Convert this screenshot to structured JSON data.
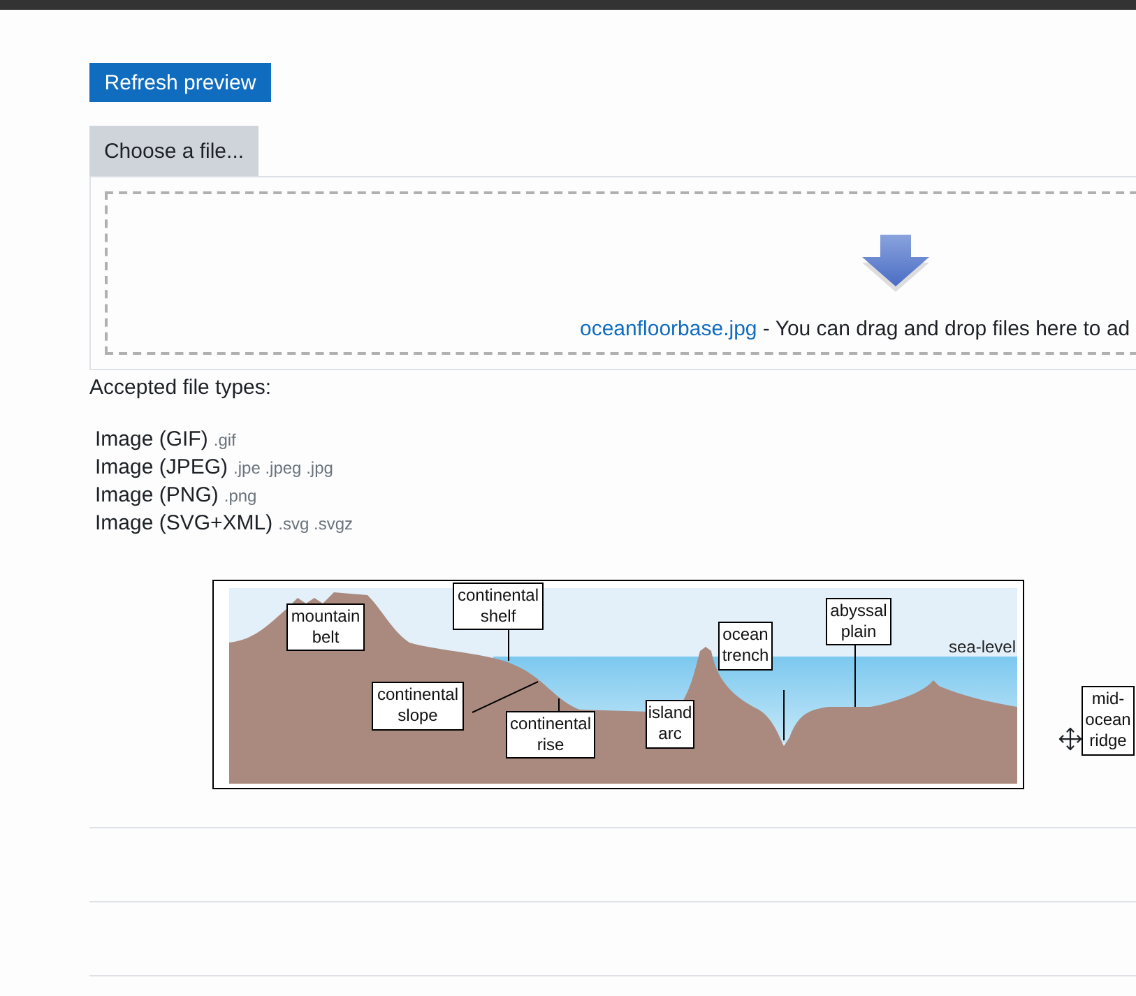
{
  "refresh_button": "Refresh preview",
  "file_picker": {
    "button": "Choose a file...",
    "file_name": "oceanfloorbase.jpg",
    "drop_hint": " - You can drag and drop files here to ad"
  },
  "accepted": {
    "heading": "Accepted file types:",
    "types": [
      {
        "name": "Image (GIF)",
        "extensions": ".gif"
      },
      {
        "name": "Image (JPEG)",
        "extensions": ".jpe .jpeg .jpg"
      },
      {
        "name": "Image (PNG)",
        "extensions": ".png"
      },
      {
        "name": "Image (SVG+XML)",
        "extensions": ".svg .svgz"
      }
    ]
  },
  "diagram": {
    "sea_label": "sea-level",
    "labels": [
      {
        "text": "mountain belt"
      },
      {
        "text": "continental shelf"
      },
      {
        "text": "continental slope"
      },
      {
        "text": "continental rise"
      },
      {
        "text": "island arc"
      },
      {
        "text": "ocean trench"
      },
      {
        "text": "abyssal plain"
      },
      {
        "text": "mid-ocean ridge"
      }
    ]
  }
}
